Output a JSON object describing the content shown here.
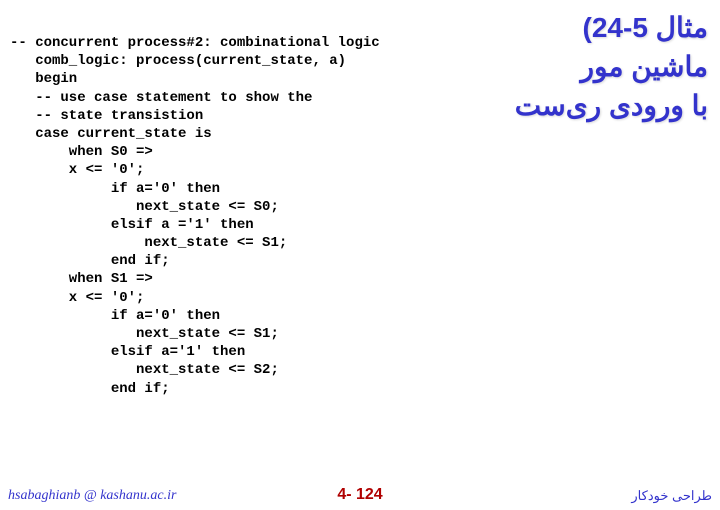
{
  "title": {
    "line1": "مثال 5-24)",
    "line2": "ماشین مور",
    "line3": "با ورودی ری‌ست"
  },
  "code": "-- concurrent process#2: combinational logic\n   comb_logic: process(current_state, a)\n   begin\n   -- use case statement to show the\n   -- state transistion\n   case current_state is\n       when S0 =>\n       x <= '0';\n            if a='0' then\n               next_state <= S0;\n            elsif a ='1' then\n                next_state <= S1;\n            end if;\n       when S1 =>\n       x <= '0';\n            if a='0' then\n               next_state <= S1;\n            elsif a='1' then\n               next_state <= S2;\n            end if;",
  "footer": {
    "left": "hsabaghianb @ kashanu.ac.ir",
    "center": "4- 124",
    "right": "طراحی خودکار"
  },
  "chart_data": {
    "type": "table",
    "description": "VHDL code excerpt: combinational logic process with case statement on current_state",
    "process_name": "comb_logic",
    "sensitivity_list": [
      "current_state",
      "a"
    ],
    "states": [
      {
        "name": "S0",
        "output_x": "0",
        "transitions": [
          {
            "condition": "a='0'",
            "next_state": "S0"
          },
          {
            "condition": "a='1'",
            "next_state": "S1"
          }
        ]
      },
      {
        "name": "S1",
        "output_x": "0",
        "transitions": [
          {
            "condition": "a='0'",
            "next_state": "S1"
          },
          {
            "condition": "a='1'",
            "next_state": "S2"
          }
        ]
      }
    ]
  }
}
